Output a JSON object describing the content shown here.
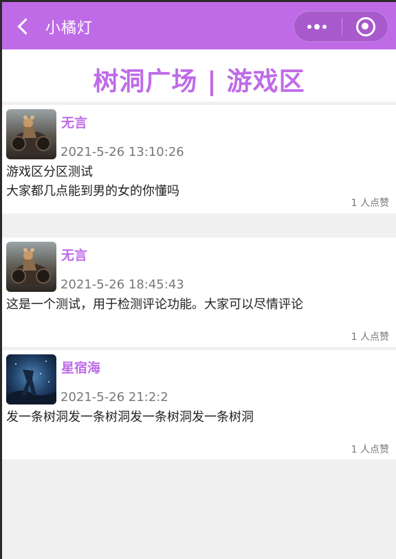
{
  "navbar": {
    "title": "小橘灯",
    "back_icon": "chevron-left-icon",
    "more_icon": "more-dots-icon",
    "close_icon": "target-circle-icon",
    "bg_color": "#bf6be8"
  },
  "page": {
    "title": "树洞广场 | 游戏区",
    "accent_color": "#bf6be8"
  },
  "posts": [
    {
      "username": "无言",
      "avatar": "game-character-avatar",
      "time": "2021-5-26 13:10:26",
      "content": "游戏区分区测试\n大家都几点能到男的女的你懂吗",
      "likes": "1 人点赞"
    },
    {
      "username": "无言",
      "avatar": "game-character-avatar",
      "time": "2021-5-26 18:45:43",
      "content": "这是一个测试，用于检测评论功能。大家可以尽情评论",
      "likes": "1 人点赞"
    },
    {
      "username": "星宿海",
      "avatar": "blue-night-avatar",
      "time": "2021-5-26 21:2:2",
      "content": "发一条树洞发一条树洞发一条树洞发一条树洞",
      "likes": "1 人点赞"
    }
  ]
}
